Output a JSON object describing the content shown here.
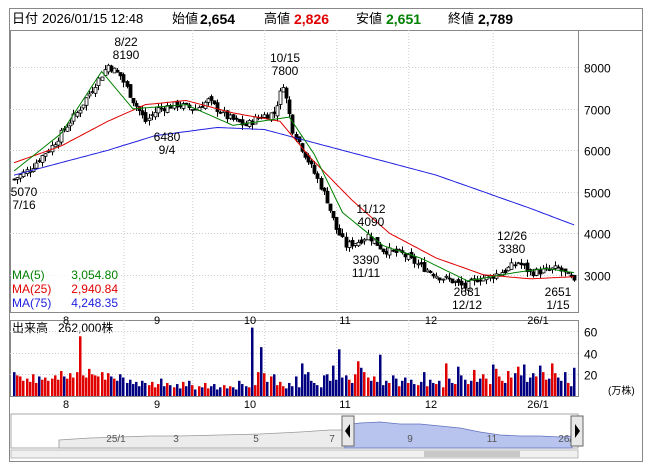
{
  "header": {
    "date_label": "日付",
    "date": "2026/01/15 12:48",
    "open_label": "始値",
    "open": "2,654",
    "high_label": "高値",
    "high": "2,826",
    "low_label": "安値",
    "low": "2,651",
    "close_label": "終値",
    "close": "2,789"
  },
  "colors": {
    "high": "#e00000",
    "low": "#008000",
    "ma5": "#008000",
    "ma25": "#e00000",
    "ma75": "#2020e0",
    "volume": "#000080",
    "volume_up": "#e00000",
    "navigator_fill": "#b8c4ee"
  },
  "chart_data": [
    {
      "type": "candlestick",
      "price_axis_ticks": [
        8000,
        7000,
        6000,
        5000,
        4000,
        3000
      ],
      "ylim": [
        2100,
        8900
      ],
      "month_labels": [
        "8",
        "9",
        "10",
        "11",
        "12",
        "26/1"
      ],
      "legend": [
        {
          "name": "MA(5)",
          "value": "3,054.80"
        },
        {
          "name": "MA(25)",
          "value": "2,940.84"
        },
        {
          "name": "MA(75)",
          "value": "4,248.35"
        }
      ],
      "annotations": [
        {
          "date": "7/16",
          "price": "5070",
          "kind": "low"
        },
        {
          "date": "8/22",
          "price": "8190",
          "kind": "high"
        },
        {
          "date": "9/4",
          "price": "6480",
          "kind": "low"
        },
        {
          "date": "10/15",
          "price": "7800",
          "kind": "high"
        },
        {
          "date": "11/11",
          "price": "3390",
          "kind": "low"
        },
        {
          "date": "11/12",
          "price": "4090",
          "kind": "high"
        },
        {
          "date": "12/12",
          "price": "2631",
          "kind": "low"
        },
        {
          "date": "12/26",
          "price": "3380",
          "kind": "high"
        },
        {
          "date": "1/15",
          "price": "2651",
          "kind": "low"
        }
      ],
      "ma75_anchors": [
        [
          0,
          5400
        ],
        [
          30,
          6000
        ],
        [
          45,
          6350
        ],
        [
          65,
          6550
        ],
        [
          80,
          6500
        ],
        [
          95,
          6200
        ],
        [
          105,
          6000
        ],
        [
          120,
          5700
        ],
        [
          135,
          5400
        ],
        [
          150,
          5000
        ],
        [
          165,
          4600
        ],
        [
          179,
          4200
        ]
      ],
      "ma25_anchors": [
        [
          0,
          5700
        ],
        [
          15,
          6100
        ],
        [
          30,
          6700
        ],
        [
          42,
          7100
        ],
        [
          55,
          7200
        ],
        [
          70,
          6900
        ],
        [
          85,
          6700
        ],
        [
          95,
          5800
        ],
        [
          108,
          4800
        ],
        [
          120,
          4000
        ],
        [
          135,
          3400
        ],
        [
          150,
          3000
        ],
        [
          165,
          2900
        ],
        [
          179,
          2950
        ]
      ],
      "ma5_anchors": [
        [
          0,
          5500
        ],
        [
          15,
          6400
        ],
        [
          28,
          7900
        ],
        [
          38,
          7000
        ],
        [
          55,
          7100
        ],
        [
          70,
          6600
        ],
        [
          88,
          6800
        ],
        [
          96,
          5900
        ],
        [
          105,
          4500
        ],
        [
          118,
          3700
        ],
        [
          130,
          3400
        ],
        [
          145,
          2850
        ],
        [
          160,
          3050
        ],
        [
          170,
          3150
        ],
        [
          179,
          3050
        ]
      ],
      "close_anchors": [
        [
          0,
          5300
        ],
        [
          5,
          5550
        ],
        [
          12,
          6100
        ],
        [
          20,
          6900
        ],
        [
          26,
          7600
        ],
        [
          30,
          8050
        ],
        [
          34,
          7800
        ],
        [
          38,
          7200
        ],
        [
          42,
          6700
        ],
        [
          46,
          7000
        ],
        [
          52,
          7100
        ],
        [
          58,
          7000
        ],
        [
          62,
          7200
        ],
        [
          68,
          6800
        ],
        [
          74,
          6600
        ],
        [
          78,
          6800
        ],
        [
          83,
          6900
        ],
        [
          86,
          7600
        ],
        [
          89,
          6500
        ],
        [
          93,
          5900
        ],
        [
          97,
          5300
        ],
        [
          100,
          4800
        ],
        [
          103,
          4100
        ],
        [
          106,
          3700
        ],
        [
          110,
          3800
        ],
        [
          113,
          3950
        ],
        [
          118,
          3600
        ],
        [
          124,
          3500
        ],
        [
          130,
          3200
        ],
        [
          136,
          2950
        ],
        [
          140,
          2850
        ],
        [
          144,
          2700
        ],
        [
          148,
          2900
        ],
        [
          152,
          2950
        ],
        [
          157,
          3100
        ],
        [
          161,
          3300
        ],
        [
          165,
          3050
        ],
        [
          170,
          3100
        ],
        [
          174,
          3150
        ],
        [
          178,
          2900
        ],
        [
          179,
          2789
        ]
      ]
    },
    {
      "type": "bar",
      "title": "出来高",
      "value": "262,000株",
      "ticks": [
        60,
        40,
        20
      ],
      "unit": "(万株)",
      "ylim": [
        0,
        70
      ],
      "values": [
        22,
        19,
        18,
        14,
        16,
        13,
        20,
        12,
        18,
        15,
        17,
        14,
        16,
        19,
        15,
        23,
        18,
        16,
        21,
        17,
        22,
        55,
        19,
        17,
        25,
        20,
        19,
        18,
        22,
        15,
        21,
        18,
        16,
        14,
        20,
        17,
        12,
        15,
        11,
        13,
        9,
        14,
        12,
        10,
        13,
        8,
        11,
        16,
        9,
        12,
        10,
        8,
        11,
        7,
        13,
        9,
        14,
        10,
        6,
        9,
        8,
        12,
        7,
        9,
        11,
        6,
        8,
        10,
        7,
        9,
        8,
        6,
        14,
        11,
        9,
        8,
        63,
        10,
        22,
        45,
        21,
        13,
        18,
        20,
        10,
        13,
        9,
        7,
        12,
        9,
        18,
        8,
        30,
        20,
        22,
        14,
        12,
        10,
        8,
        19,
        20,
        14,
        28,
        15,
        43,
        17,
        19,
        15,
        12,
        20,
        32,
        26,
        22,
        17,
        14,
        18,
        13,
        38,
        10,
        14,
        12,
        19,
        16,
        9,
        14,
        17,
        12,
        15,
        11,
        10,
        13,
        22,
        9,
        15,
        12,
        11,
        14,
        8,
        30,
        16,
        12,
        11,
        27,
        19,
        15,
        11,
        14,
        24,
        13,
        16,
        20,
        16,
        11,
        29,
        25,
        18,
        14,
        12,
        23,
        17,
        21,
        27,
        19,
        29,
        13,
        17,
        21,
        18,
        28,
        22,
        15,
        16,
        30,
        21,
        17,
        14,
        22,
        12,
        9,
        26
      ],
      "up_mask_note": "colors per bar follow price direction"
    },
    {
      "type": "area",
      "title": "navigator",
      "labels": [
        "25/1",
        "3",
        "5",
        "7",
        "9",
        "11",
        "26/1"
      ]
    }
  ]
}
